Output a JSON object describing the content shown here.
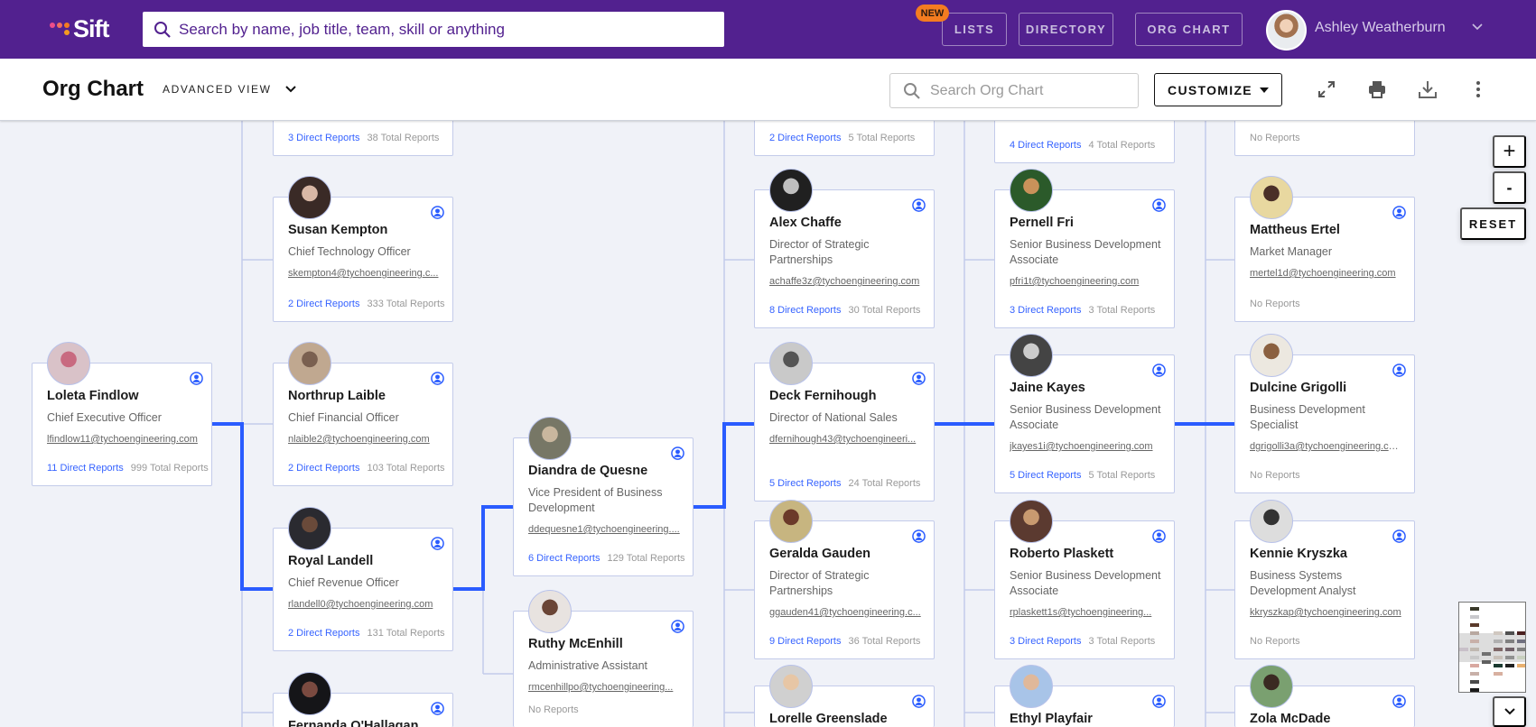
{
  "topbar": {
    "logo_text": "Sift",
    "search_placeholder": "Search by name, job title, team, skill or anything",
    "new_badge": "NEW",
    "nav": [
      "LISTS",
      "DIRECTORY",
      "ORG CHART"
    ],
    "user_name": "Ashley Weatherburn"
  },
  "subbar": {
    "title": "Org Chart",
    "view_label": "ADVANCED VIEW",
    "search_placeholder": "Search Org Chart",
    "customize_label": "CUSTOMIZE"
  },
  "zoom": {
    "plus": "+",
    "minus": "-",
    "reset": "RESET"
  },
  "colors": {
    "brand": "#52218f",
    "accent": "#2a5cff",
    "badge": "#f47c20"
  },
  "columns": [
    {
      "cards": [
        {
          "name": "Loleta Findlow",
          "title": "Chief Executive Officer",
          "email": "lfindlow11@tychoengineering.com",
          "direct": "11 Direct Reports",
          "total": "999 Total Reports"
        }
      ]
    },
    {
      "cards": [
        {
          "direct": "3 Direct Reports",
          "total": "38 Total Reports"
        },
        {
          "name": "Susan Kempton",
          "title": "Chief Technology Officer",
          "email": "skempton4@tychoengineering.c...",
          "direct": "2 Direct Reports",
          "total": "333 Total Reports"
        },
        {
          "name": "Northrup Laible",
          "title": "Chief Financial Officer",
          "email": "nlaible2@tychoengineering.com",
          "direct": "2 Direct Reports",
          "total": "103 Total Reports"
        },
        {
          "name": "Royal Landell",
          "title": "Chief Revenue Officer",
          "email": "rlandell0@tychoengineering.com",
          "direct": "2 Direct Reports",
          "total": "131 Total Reports"
        },
        {
          "name": "Fernanda O'Hallagan"
        }
      ]
    },
    {
      "cards": [
        {
          "name": "Diandra de Quesne",
          "title": "Vice President of Business Development",
          "email": "ddequesne1@tychoengineering....",
          "direct": "6 Direct Reports",
          "total": "129 Total Reports"
        },
        {
          "name": "Ruthy McEnhill",
          "title": "Administrative Assistant",
          "email": "rmcenhillpo@tychoengineering...",
          "none": "No Reports"
        }
      ]
    },
    {
      "cards": [
        {
          "direct": "2 Direct Reports",
          "total": "5 Total Reports"
        },
        {
          "name": "Alex Chaffe",
          "title": "Director of Strategic Partnerships",
          "email": "achaffe3z@tychoengineering.com",
          "direct": "8 Direct Reports",
          "total": "30 Total Reports"
        },
        {
          "name": "Deck Fernihough",
          "title": "Director of National Sales",
          "email": "dfernihough43@tychoengineeri...",
          "direct": "5 Direct Reports",
          "total": "24 Total Reports"
        },
        {
          "name": "Geralda Gauden",
          "title": "Director of Strategic Partnerships",
          "email": "ggauden41@tychoengineering.c...",
          "direct": "9 Direct Reports",
          "total": "36 Total Reports"
        },
        {
          "name": "Lorelle Greenslade"
        }
      ]
    },
    {
      "cards": [
        {
          "direct": "4 Direct Reports",
          "total": "4 Total Reports"
        },
        {
          "name": "Pernell Fri",
          "title": "Senior Business Development Associate",
          "email": "pfri1t@tychoengineering.com",
          "direct": "3 Direct Reports",
          "total": "3 Total Reports"
        },
        {
          "name": "Jaine Kayes",
          "title": "Senior Business Development Associate",
          "email": "jkayes1i@tychoengineering.com",
          "direct": "5 Direct Reports",
          "total": "5 Total Reports"
        },
        {
          "name": "Roberto Plaskett",
          "title": "Senior Business Development Associate",
          "email": "rplaskett1s@tychoengineering...",
          "direct": "3 Direct Reports",
          "total": "3 Total Reports"
        },
        {
          "name": "Ethyl Playfair"
        }
      ]
    },
    {
      "cards": [
        {
          "none": "No Reports"
        },
        {
          "name": "Mattheus Ertel",
          "title": "Market Manager",
          "email": "mertel1d@tychoengineering.com",
          "none": "No Reports"
        },
        {
          "name": "Dulcine Grigolli",
          "title": "Business Development Specialist",
          "email": "dgrigolli3a@tychoengineering.com",
          "none": "No Reports"
        },
        {
          "name": "Kennie Kryszka",
          "title": "Business Systems Development Analyst",
          "email": "kkryszkap@tychoengineering.com",
          "none": "No Reports"
        },
        {
          "name": "Zola McDade"
        }
      ]
    }
  ]
}
